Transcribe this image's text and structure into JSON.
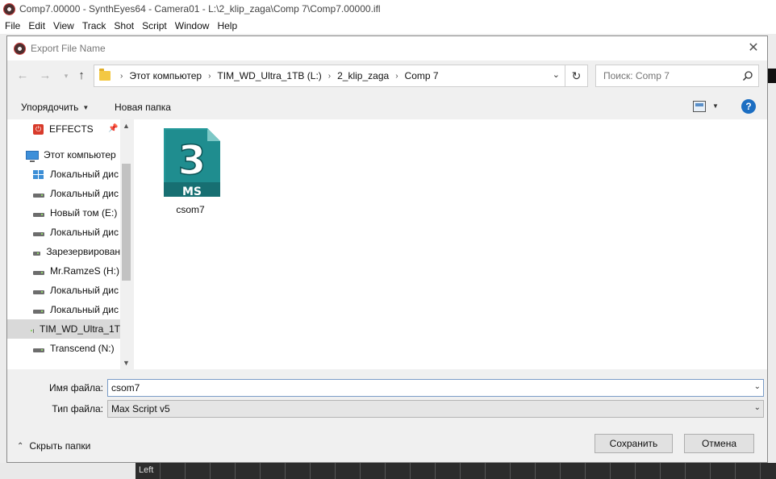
{
  "app": {
    "title": "Comp7.00000 - SynthEyes64 - Camera01 - L:\\2_klip_zaga\\Comp 7\\Comp7.00000.ifl",
    "menu": [
      "File",
      "Edit",
      "View",
      "Track",
      "Shot",
      "Script",
      "Window",
      "Help"
    ],
    "viewport_label": "Left"
  },
  "dialog": {
    "title": "Export File Name",
    "breadcrumbs": [
      "Этот компьютер",
      "TIM_WD_Ultra_1TB (L:)",
      "2_klip_zaga",
      "Comp 7"
    ],
    "search_placeholder": "Поиск: Comp 7",
    "toolbar": {
      "organize_label": "Упорядочить",
      "new_folder_label": "Новая папка",
      "help_label": "?"
    },
    "nav_items": [
      {
        "label": "EFFECTS",
        "icon": "effects-icon"
      },
      {
        "label": "Этот компьютер",
        "icon": "computer-icon"
      },
      {
        "label": "Локальный дис",
        "icon": "windows-drive-icon"
      },
      {
        "label": "Локальный дис",
        "icon": "drive-icon"
      },
      {
        "label": "Новый том (E:)",
        "icon": "drive-icon"
      },
      {
        "label": "Локальный дис",
        "icon": "drive-icon"
      },
      {
        "label": "Зарезервирован",
        "icon": "drive-icon"
      },
      {
        "label": "Mr.RamzeS (H:)",
        "icon": "drive-icon"
      },
      {
        "label": "Локальный дис",
        "icon": "drive-icon"
      },
      {
        "label": "Локальный дис",
        "icon": "drive-icon"
      },
      {
        "label": "TIM_WD_Ultra_1T",
        "icon": "drive-icon"
      },
      {
        "label": "Transcend (N:)",
        "icon": "drive-icon"
      }
    ],
    "files": [
      {
        "name": "csom7",
        "icon_text": "3",
        "icon_badge": "MS"
      }
    ],
    "filename_label": "Имя файла:",
    "filename_value": "csom7",
    "filetype_label": "Тип файла:",
    "filetype_value": "Max Script v5",
    "hide_folders_label": "Скрыть папки",
    "save_label": "Сохранить",
    "cancel_label": "Отмена"
  },
  "colors": {
    "accent": "#1c6ec2",
    "file_icon_teal": "#1e8a8a",
    "folder_yellow": "#f3c843"
  }
}
